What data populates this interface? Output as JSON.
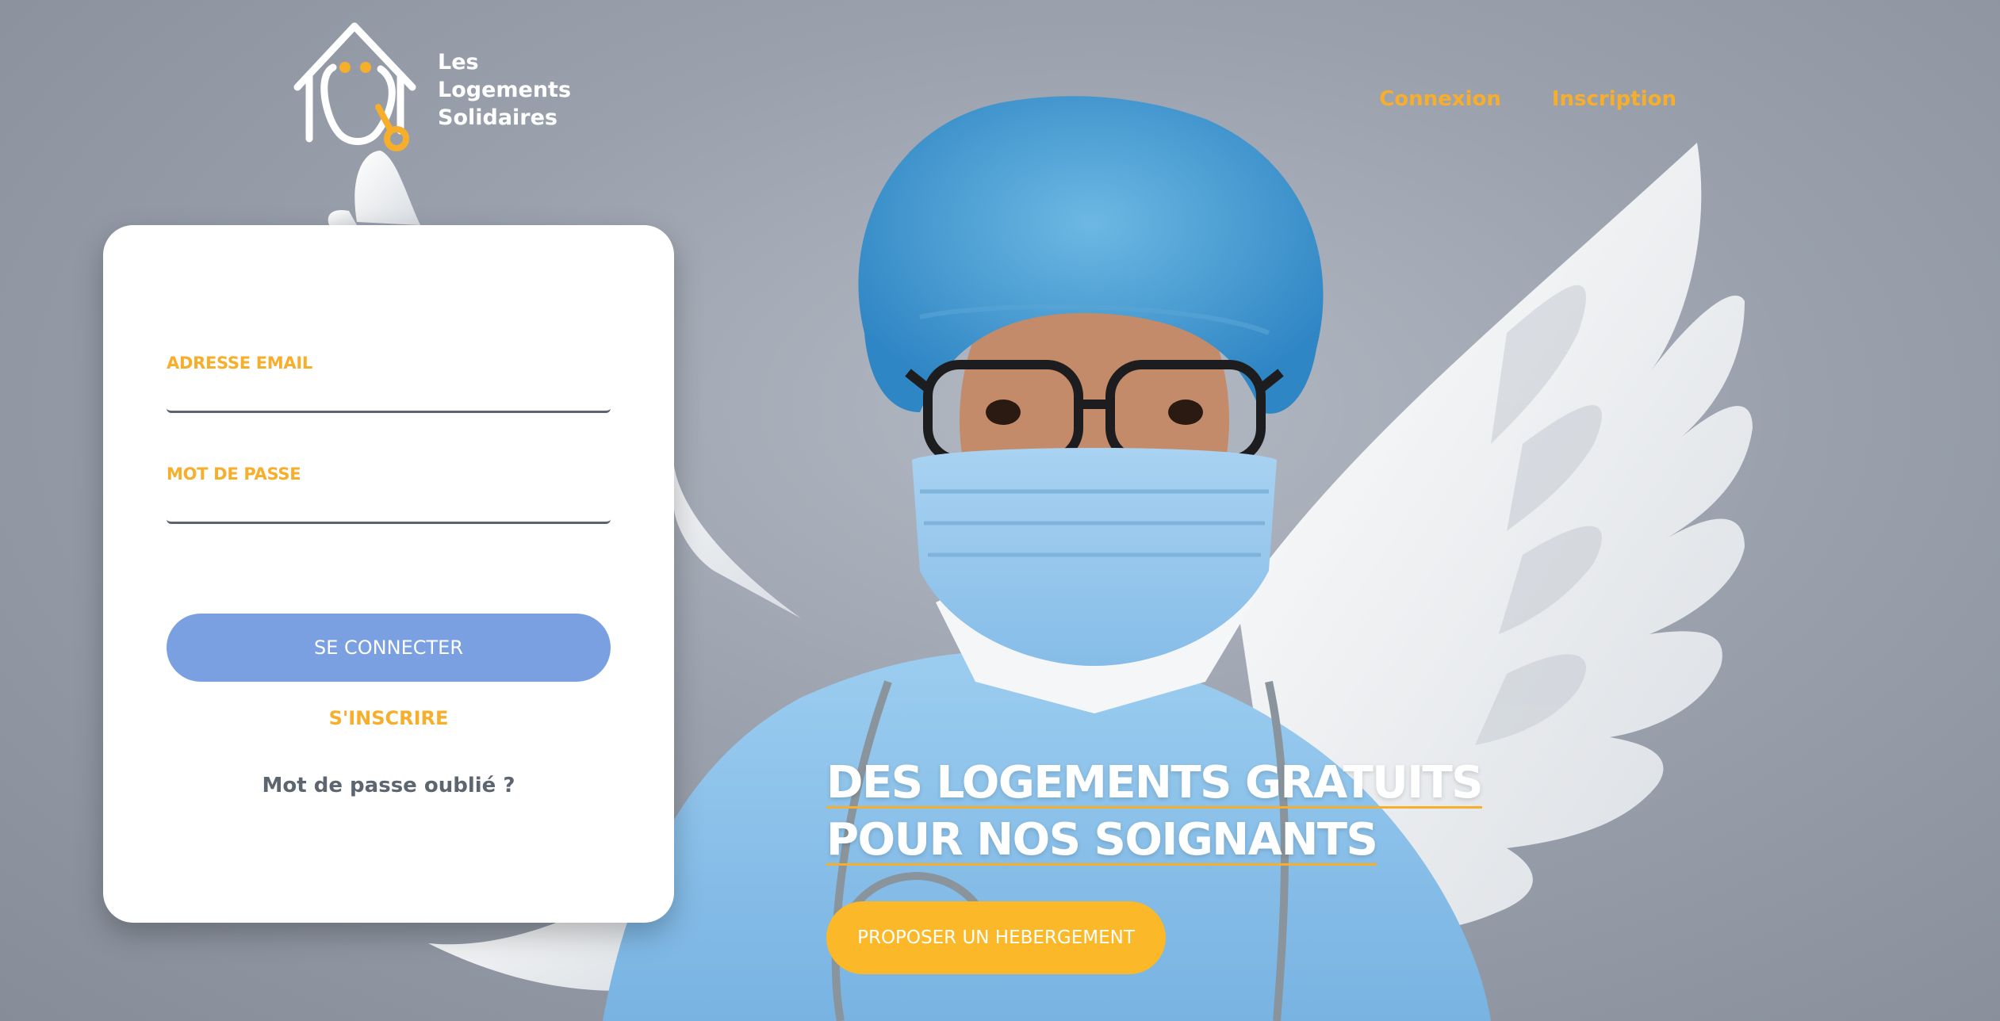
{
  "brand": {
    "logo_lines": [
      "Les",
      "Logements",
      "Solidaires"
    ],
    "icon": "house-stethoscope-icon"
  },
  "nav": {
    "login": "Connexion",
    "signup": "Inscription"
  },
  "login_form": {
    "email_label": "ADRESSE EMAIL",
    "email_value": "",
    "password_label": "MOT DE PASSE",
    "password_value": "",
    "submit": "SE CONNECTER",
    "register": "S'INSCRIRE",
    "forgot": "Mot de passe oublié ?"
  },
  "hero": {
    "title_line1": "DES LOGEMENTS GRATUITS",
    "title_line2": "POUR NOS SOIGNANTS",
    "cta": "PROPOSER UN HEBERGEMENT"
  },
  "colors": {
    "accent": "#f7ae2b",
    "button_blue": "#7aa0e1",
    "background": "#9aa1ad",
    "scrubs": "#8ec3ea"
  }
}
